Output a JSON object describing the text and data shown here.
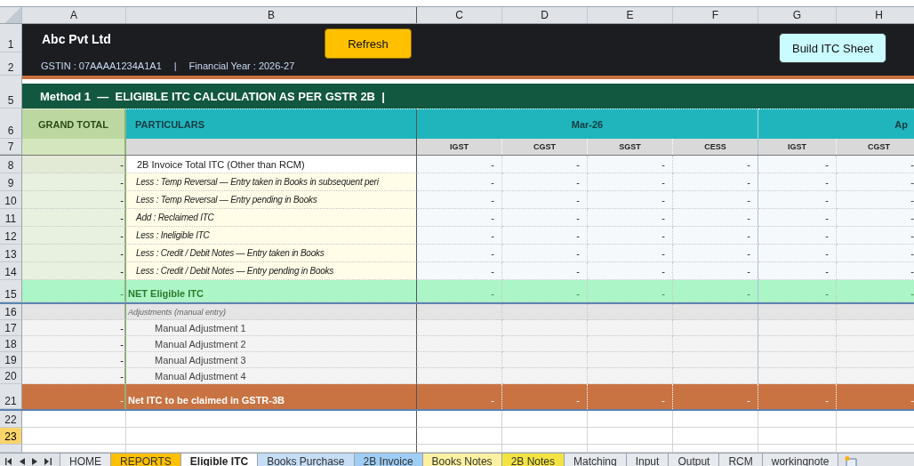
{
  "columns": [
    "A",
    "B",
    "C",
    "D",
    "E",
    "F",
    "G",
    "H"
  ],
  "row_headers": [
    {
      "label": "1",
      "selected": false
    },
    {
      "label": "2",
      "selected": false
    },
    {
      "label": "5",
      "selected": false
    },
    {
      "label": "6",
      "selected": false
    },
    {
      "label": "7",
      "selected": false
    },
    {
      "label": "8",
      "selected": false
    },
    {
      "label": "9",
      "selected": false
    },
    {
      "label": "10",
      "selected": false
    },
    {
      "label": "11",
      "selected": false
    },
    {
      "label": "12",
      "selected": false
    },
    {
      "label": "13",
      "selected": false
    },
    {
      "label": "14",
      "selected": false
    },
    {
      "label": "15",
      "selected": false
    },
    {
      "label": "16",
      "selected": false
    },
    {
      "label": "17",
      "selected": false
    },
    {
      "label": "18",
      "selected": false
    },
    {
      "label": "19",
      "selected": false
    },
    {
      "label": "20",
      "selected": false
    },
    {
      "label": "21",
      "selected": false
    },
    {
      "label": "22",
      "selected": false
    },
    {
      "label": "23",
      "selected": true
    }
  ],
  "header": {
    "company": "Abc Pvt Ltd",
    "gstin": "GSTIN : 07AAAA1234A1A1",
    "separator": "|",
    "financial_year": "Financial Year : 2026-27",
    "refresh_button": "Refresh",
    "build_button": "Build ITC Sheet"
  },
  "section_title": "Method 1  —  ELIGIBLE ITC CALCULATION AS PER GSTR 2B  |",
  "grand_total_heading": "GRAND TOTAL",
  "particulars_heading": "PARTICULARS",
  "months": [
    "Mar-26",
    "Ap"
  ],
  "tax_columns": [
    "IGST",
    "CGST",
    "SGST",
    "CESS",
    "IGST",
    "CGST"
  ],
  "rows": [
    {
      "kind": "base",
      "grand_total": "-",
      "particular": "2B Invoice Total ITC (Other than RCM)",
      "values": [
        "-",
        "-",
        "-",
        "-",
        "-",
        "-"
      ]
    },
    {
      "kind": "adjust",
      "grand_total": "-",
      "particular": "Less : Temp Reversal — Entry taken in Books in subsequent peri",
      "values": [
        "-",
        "-",
        "-",
        "-",
        "-",
        "-"
      ]
    },
    {
      "kind": "adjust",
      "grand_total": "-",
      "particular": "Less : Temp Reversal — Entry pending in Books",
      "values": [
        "-",
        "-",
        "-",
        "-",
        "-",
        "-"
      ]
    },
    {
      "kind": "adjust",
      "grand_total": "-",
      "particular": "Add  : Reclaimed ITC",
      "values": [
        "-",
        "-",
        "-",
        "-",
        "-",
        "-"
      ]
    },
    {
      "kind": "adjust",
      "grand_total": "-",
      "particular": "Less : Ineligible ITC",
      "values": [
        "-",
        "-",
        "-",
        "-",
        "-",
        "-"
      ]
    },
    {
      "kind": "adjust",
      "grand_total": "-",
      "particular": "Less : Credit / Debit Notes — Entry taken in Books",
      "values": [
        "-",
        "-",
        "-",
        "-",
        "-",
        "-"
      ]
    },
    {
      "kind": "adjust",
      "grand_total": "-",
      "particular": "Less : Credit / Debit Notes — Entry pending in Books",
      "values": [
        "-",
        "-",
        "-",
        "-",
        "-",
        "-"
      ]
    },
    {
      "kind": "net",
      "grand_total": "-",
      "particular": "NET Eligible ITC",
      "values": [
        "-",
        "-",
        "-",
        "-",
        "-",
        "-"
      ]
    },
    {
      "kind": "subheading",
      "particular": "Adjustments (manual entry)"
    },
    {
      "kind": "manual",
      "grand_total": "-",
      "particular": "Manual Adjustment 1"
    },
    {
      "kind": "manual",
      "grand_total": "-",
      "particular": "Manual Adjustment 2"
    },
    {
      "kind": "manual",
      "grand_total": "-",
      "particular": "Manual Adjustment 3"
    },
    {
      "kind": "manual",
      "grand_total": "-",
      "particular": "Manual Adjustment 4"
    },
    {
      "kind": "final",
      "grand_total": "-",
      "particular": "Net ITC to be claimed in GSTR-3B",
      "values": [
        "-",
        "-",
        "-",
        "-",
        "-",
        "-"
      ]
    }
  ],
  "tabs": [
    {
      "label": "HOME",
      "selected": false
    },
    {
      "label": "REPORTS",
      "selected": false,
      "color": "#ffc000"
    },
    {
      "label": "Eligible ITC",
      "selected": true
    },
    {
      "label": "Books Purchase",
      "selected": false,
      "color": "#c5def5"
    },
    {
      "label": "2B Invoice",
      "selected": false,
      "color": "#9fcdf5"
    },
    {
      "label": "Books Notes",
      "selected": false,
      "color": "#fbf1a0"
    },
    {
      "label": "2B Notes",
      "selected": false,
      "color": "#f4e443"
    },
    {
      "label": "Matching",
      "selected": false
    },
    {
      "label": "Input",
      "selected": false
    },
    {
      "label": "Output",
      "selected": false
    },
    {
      "label": "RCM",
      "selected": false
    },
    {
      "label": "workingnote",
      "selected": false
    }
  ]
}
